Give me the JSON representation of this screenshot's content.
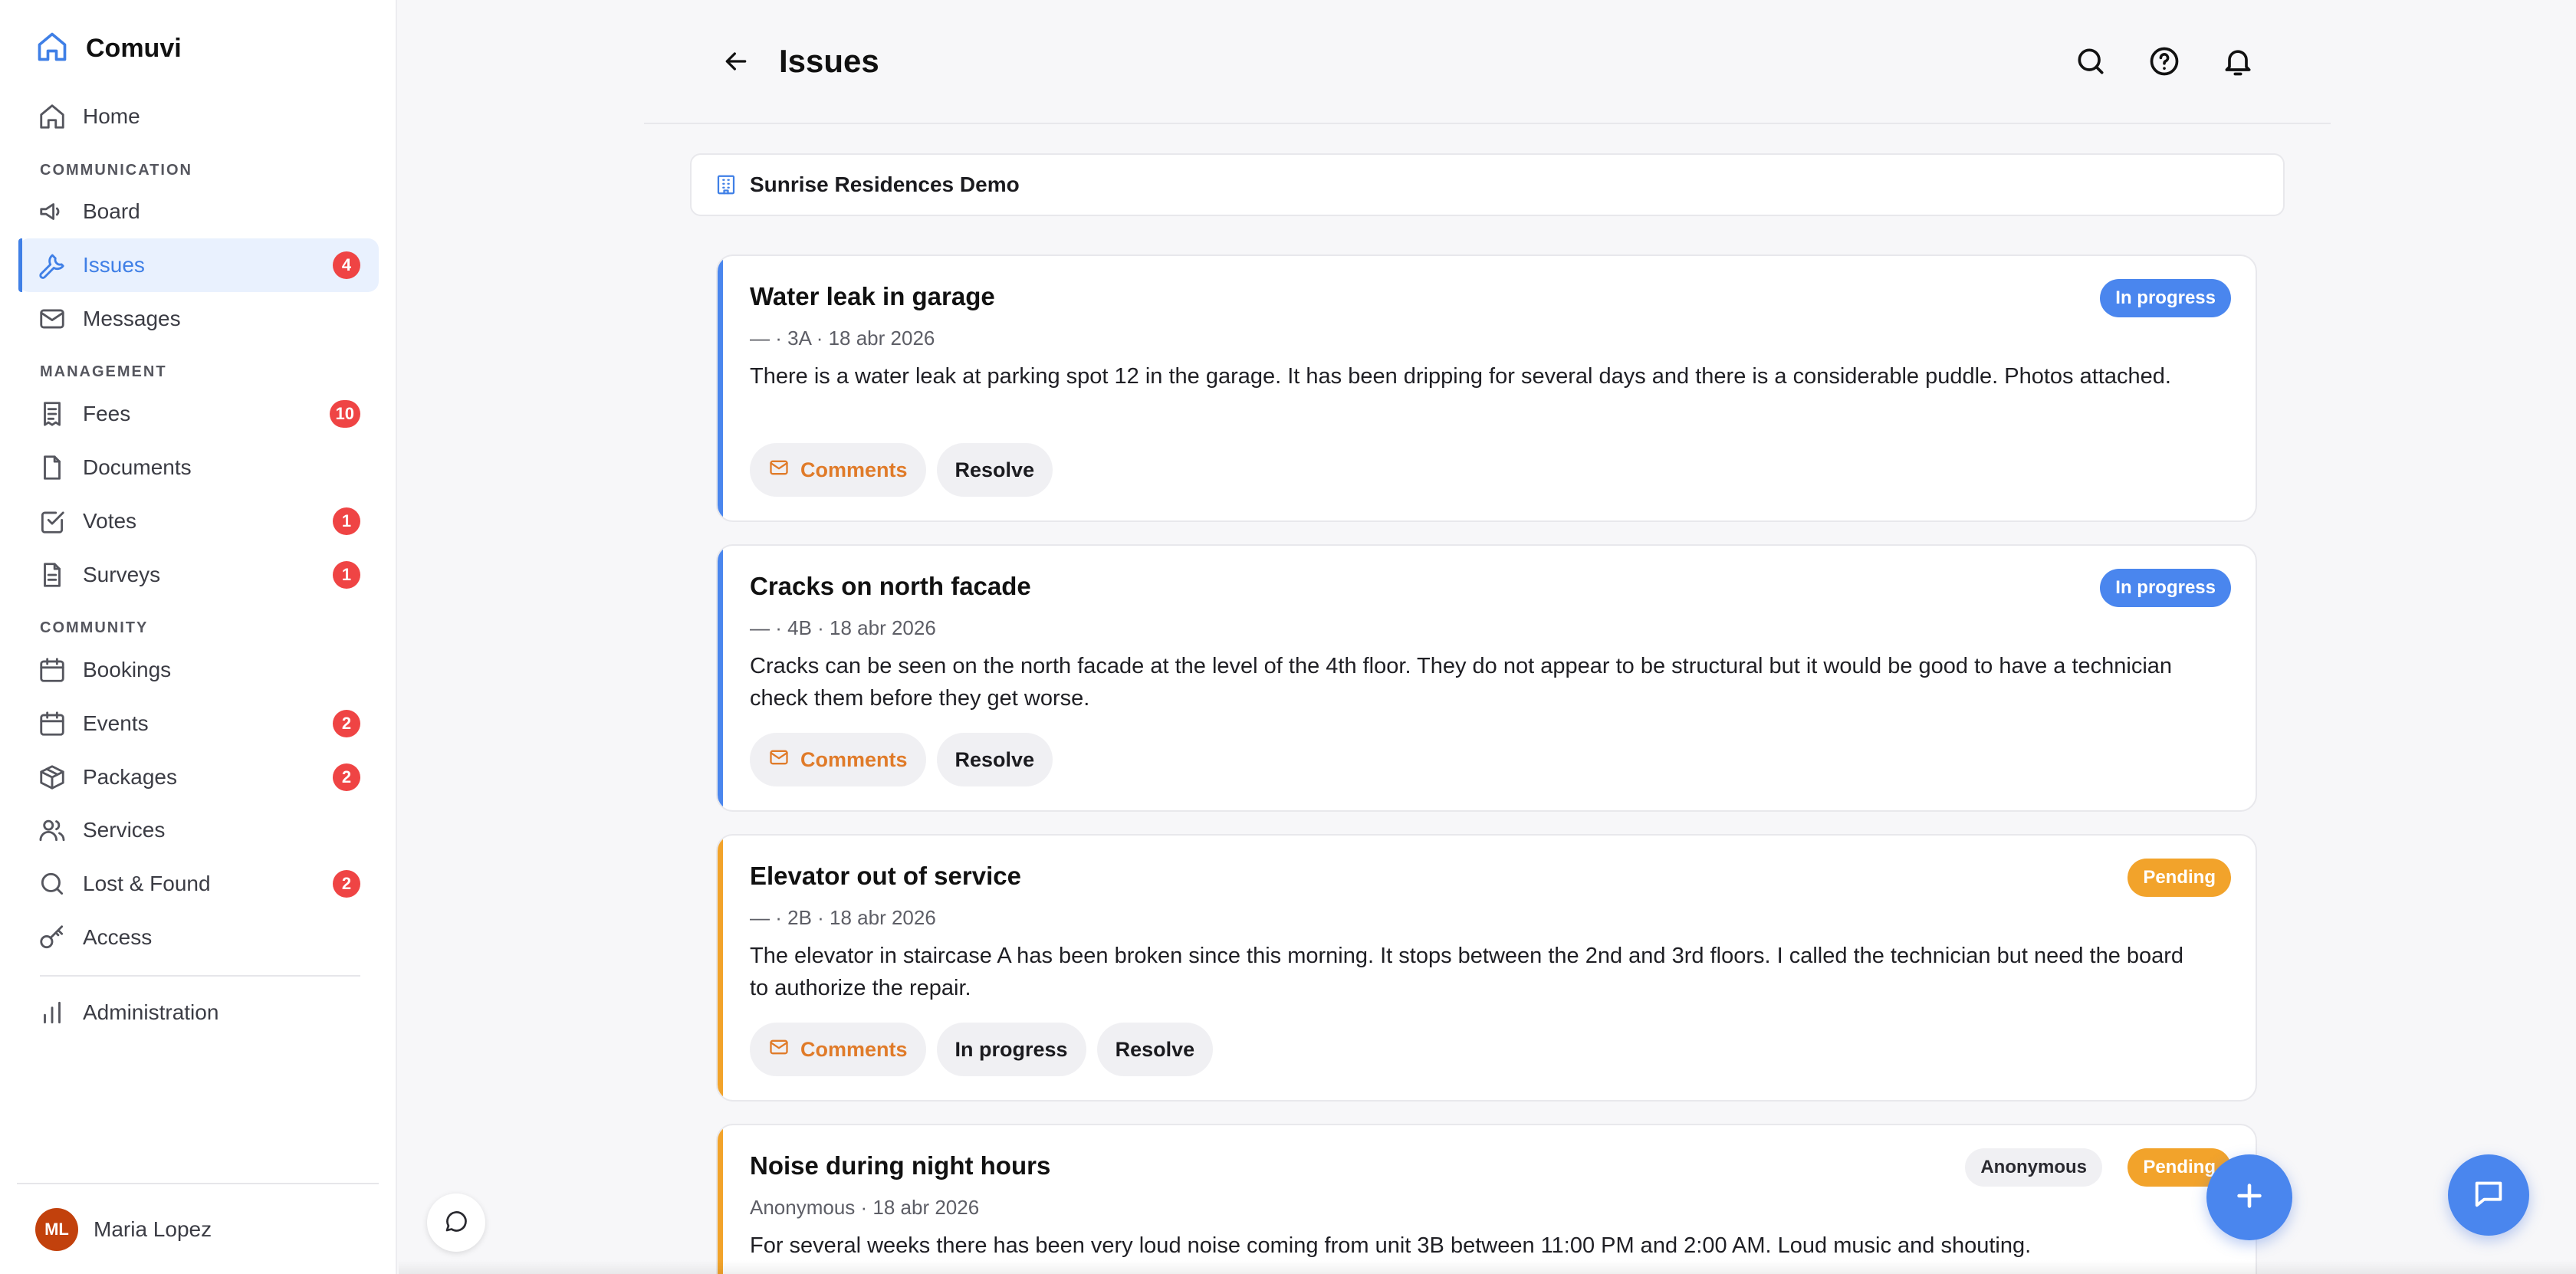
{
  "app": {
    "name": "Comuvi"
  },
  "sidebar": {
    "sections": {
      "communication": "COMMUNICATION",
      "management": "MANAGEMENT",
      "community": "COMMUNITY"
    },
    "items": {
      "home": {
        "label": "Home",
        "icon": "home-icon"
      },
      "board": {
        "label": "Board",
        "icon": "megaphone-icon"
      },
      "issues": {
        "label": "Issues",
        "icon": "wrench-icon",
        "badge": "4",
        "active": true
      },
      "messages": {
        "label": "Messages",
        "icon": "mail-icon"
      },
      "fees": {
        "label": "Fees",
        "icon": "receipt-icon",
        "badge": "10"
      },
      "documents": {
        "label": "Documents",
        "icon": "file-icon"
      },
      "votes": {
        "label": "Votes",
        "icon": "checkbox-icon",
        "badge": "1"
      },
      "surveys": {
        "label": "Surveys",
        "icon": "clipboard-icon",
        "badge": "1"
      },
      "bookings": {
        "label": "Bookings",
        "icon": "calendar-icon"
      },
      "events": {
        "label": "Events",
        "icon": "calendar-icon",
        "badge": "2"
      },
      "packages": {
        "label": "Packages",
        "icon": "package-icon",
        "badge": "2"
      },
      "services": {
        "label": "Services",
        "icon": "users-icon"
      },
      "lost_found": {
        "label": "Lost & Found",
        "icon": "search-icon",
        "badge": "2"
      },
      "access": {
        "label": "Access",
        "icon": "key-icon"
      },
      "administration": {
        "label": "Administration",
        "icon": "bar-chart-icon"
      }
    },
    "user": {
      "initials": "ML",
      "name": "Maria Lopez"
    }
  },
  "header": {
    "title": "Issues"
  },
  "property": {
    "name": "Sunrise Residences Demo"
  },
  "issues": [
    {
      "title": "Water leak in garage",
      "meta": "— · 3A · 18 abr 2026",
      "body": "There is a water leak at parking spot 12 in the garage. It has been dripping for several days and there is a considerable puddle. Photos attached.",
      "status": "In progress",
      "actions": {
        "comments": "Comments",
        "resolve": "Resolve"
      }
    },
    {
      "title": "Cracks on north facade",
      "meta": "— · 4B · 18 abr 2026",
      "body": "Cracks can be seen on the north facade at the level of the 4th floor. They do not appear to be structural but it would be good to have a technician check them before they get worse.",
      "status": "In progress",
      "actions": {
        "comments": "Comments",
        "resolve": "Resolve"
      }
    },
    {
      "title": "Elevator out of service",
      "meta": "— · 2B · 18 abr 2026",
      "body": "The elevator in staircase A has been broken since this morning. It stops between the 2nd and 3rd floors. I called the technician but need the board to authorize the repair.",
      "status": "Pending",
      "actions": {
        "comments": "Comments",
        "in_progress": "In progress",
        "resolve": "Resolve"
      }
    },
    {
      "title": "Noise during night hours",
      "meta": "Anonymous · 18 abr 2026",
      "body": "For several weeks there has been very loud noise coming from unit 3B between 11:00 PM and 2:00 AM. Loud music and shouting.",
      "status": "Pending",
      "tag": "Anonymous"
    }
  ],
  "colors": {
    "accent": "#3f7fe6",
    "in_progress": "#4a86ee",
    "pending": "#f2a32b",
    "badge_red": "#ef4444",
    "comments_orange": "#e07b29"
  }
}
